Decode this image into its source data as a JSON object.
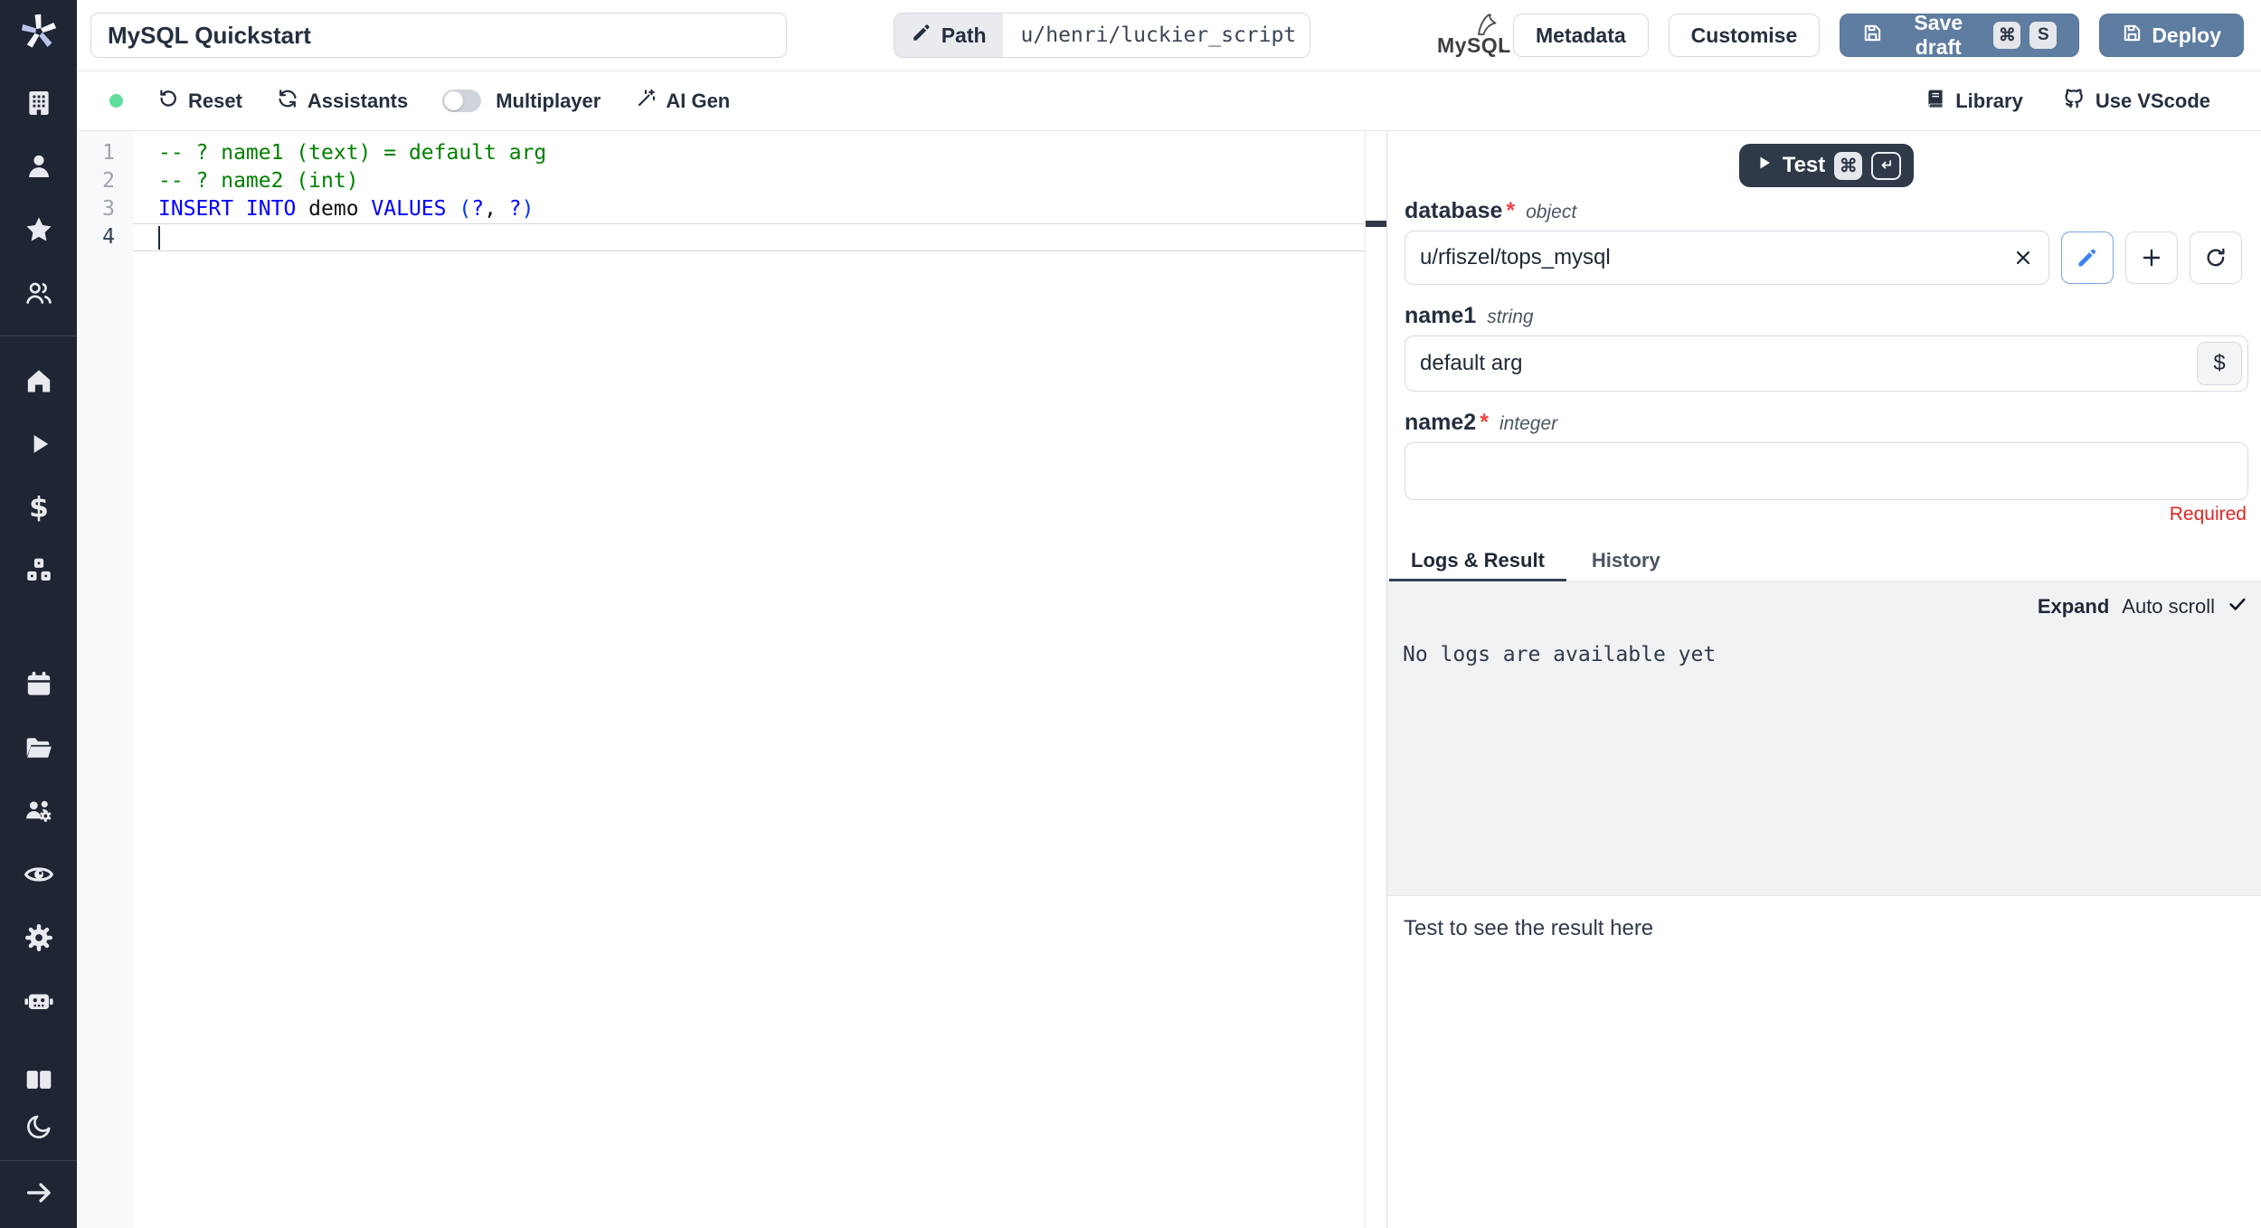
{
  "topbar": {
    "title_value": "MySQL Quickstart",
    "path_label": "Path",
    "path_value": "u/henri/luckier_script",
    "mysql_logo_text": "MySQL",
    "metadata_label": "Metadata",
    "customise_label": "Customise",
    "save_draft_label": "Save draft",
    "save_draft_shortcut": [
      "⌘",
      "S"
    ],
    "deploy_label": "Deploy"
  },
  "toolbar": {
    "reset_label": "Reset",
    "assistants_label": "Assistants",
    "multiplayer_label": "Multiplayer",
    "multiplayer_toggle_on": false,
    "ai_gen_label": "AI Gen",
    "library_label": "Library",
    "vscode_label": "Use VScode"
  },
  "sidebar": {
    "icons": [
      "windmill-logo",
      "building",
      "user",
      "star",
      "users",
      "home",
      "play",
      "dollar",
      "cubes",
      "calendar",
      "folder-open",
      "users-gear",
      "eye",
      "gear",
      "robot",
      "open-book",
      "moon",
      "arrow-right"
    ]
  },
  "editor": {
    "language": "sql",
    "active_line": "4",
    "lines": [
      {
        "num": "1",
        "tokens": [
          {
            "t": "-- ? name1 (text) = default arg",
            "c": "comment"
          }
        ]
      },
      {
        "num": "2",
        "tokens": [
          {
            "t": "-- ? name2 (int)",
            "c": "comment"
          }
        ]
      },
      {
        "num": "3",
        "tokens": [
          {
            "t": "INSERT INTO",
            "c": "kw"
          },
          {
            "t": " demo ",
            "c": "pl"
          },
          {
            "t": "VALUES ",
            "c": "kw"
          },
          {
            "t": "(",
            "c": "br"
          },
          {
            "t": "?",
            "c": "kw"
          },
          {
            "t": ", ",
            "c": "pl"
          },
          {
            "t": "?",
            "c": "kw"
          },
          {
            "t": ")",
            "c": "br"
          }
        ]
      },
      {
        "num": "4",
        "tokens": []
      }
    ]
  },
  "run_panel": {
    "test_label": "Test",
    "test_shortcut": [
      "⌘",
      "↵"
    ],
    "fields": {
      "database": {
        "name": "database",
        "required": "*",
        "type": "object",
        "value": "u/rfiszel/tops_mysql"
      },
      "name1": {
        "name": "name1",
        "type": "string",
        "value": "default arg",
        "dollar_label": "$"
      },
      "name2": {
        "name": "name2",
        "required": "*",
        "type": "integer",
        "value": "",
        "error": "Required"
      }
    },
    "tabs": {
      "logs_result": "Logs & Result",
      "history": "History"
    },
    "logs": {
      "expand_label": "Expand",
      "autoscroll_label": "Auto scroll",
      "empty_text": "No logs are available yet"
    },
    "result_placeholder": "Test to see the result here"
  },
  "colors": {
    "sidebar_bg": "#1f2533",
    "primary_button": "#5f7da0",
    "dark_button": "#2f3949",
    "status_green": "#5fdd9a",
    "required_red": "#dc2626",
    "code_comment": "#008000",
    "code_keyword": "#0000ff",
    "logs_bg": "#f1f2f4"
  }
}
